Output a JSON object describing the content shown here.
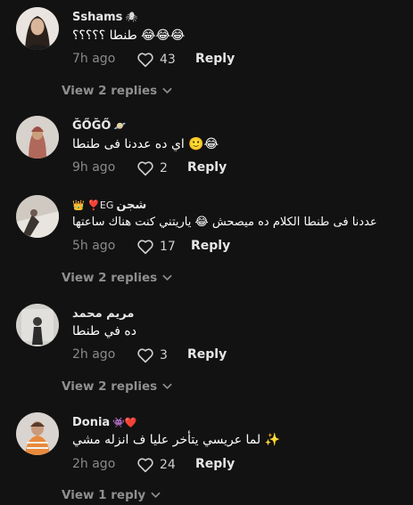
{
  "comments": [
    {
      "username": "Sshams",
      "badge": "🕷",
      "text": "طنطا ؟؟؟؟؟ 😂😂😂",
      "time": "7h ago",
      "likes": "43",
      "reply_label": "Reply",
      "view_replies": "View 2 replies"
    },
    {
      "username": "ĞŐĞŐ",
      "badge": "🪐",
      "text": "اي ده عددنا فى طنطا 🙂😂",
      "time": "9h ago",
      "likes": "2",
      "reply_label": "Reply",
      "view_replies": ""
    },
    {
      "username": "شجن",
      "badge": "👑 ❣️EG",
      "text": "عددنا فى طنطا الكلام ده ميصحش 😂 ياريتني كنت هناك ساعتها",
      "time": "5h ago",
      "likes": "17",
      "reply_label": "Reply",
      "view_replies": "View 2 replies"
    },
    {
      "username": "مريم محمد",
      "badge": "",
      "text": "ده في طنطا",
      "time": "2h ago",
      "likes": "3",
      "reply_label": "Reply",
      "view_replies": "View 2 replies"
    },
    {
      "username": "Donia",
      "badge": "👾❤️",
      "text": "لما عريسي يتأخر عليا ف انزله مشي ✨",
      "time": "2h ago",
      "likes": "24",
      "reply_label": "Reply",
      "view_replies": "View 1 reply"
    }
  ],
  "colors": {
    "background": "#121212",
    "muted_text": "#8a8a8a",
    "primary_text": "#ffffff"
  },
  "icons": {
    "like": "heart-outline-icon",
    "expand": "chevron-down-icon"
  }
}
